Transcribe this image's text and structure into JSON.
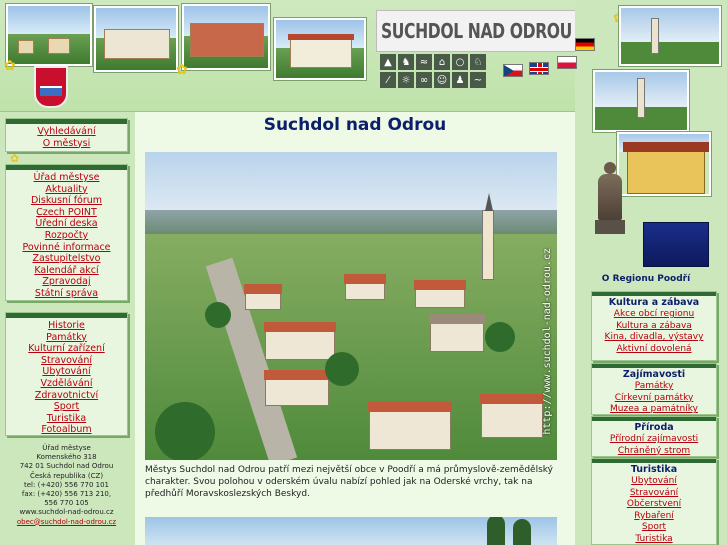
{
  "header": {
    "site_title": "SUCHDOL NAD ODROU",
    "category_icons": [
      "tent-icon",
      "hiker-icon",
      "fish-icon",
      "camp-icon",
      "cyclist-icon",
      "horse-icon",
      "ski-icon",
      "sun-icon",
      "bike-icon",
      "theater-icon",
      "running-icon",
      "waves-icon"
    ],
    "languages": [
      "de",
      "cz",
      "gb",
      "pl"
    ]
  },
  "left_nav": {
    "box1": [
      "Vyhledávání",
      "O městysi"
    ],
    "box2": [
      "Úřad městyse",
      "Aktuality",
      "Diskusní fórum",
      "Czech POINT",
      "Úřední deska",
      "Rozpočty",
      "Povinné informace",
      "Zastupitelstvo",
      "Kalendář akcí",
      "Zpravodaj",
      "Státní správa"
    ],
    "box3": [
      "Historie",
      "Památky",
      "Kulturní zařízení",
      "Stravování",
      "Ubytování",
      "Vzdělávání",
      "Zdravotnictví",
      "Sport",
      "Turistika",
      "Fotoalbum"
    ]
  },
  "address": {
    "line1": "Úřad městyse",
    "line2": "Komenského 318",
    "line3": "742 01 Suchdol nad Odrou",
    "line4": "Česká republika (CZ)",
    "line5": "tel: (+420) 556 770 101",
    "line6": "fax: (+420) 556 713 210,",
    "line7": "556 770 105",
    "line8": "www.suchdol-nad-odrou.cz",
    "email": "obec@suchdol-nad-odrou.cz"
  },
  "main": {
    "title": "Suchdol nad Odrou",
    "photo_watermark": "http://www.suchdol-nad-odrou.cz",
    "intro_text": "Městys Suchdol nad Odrou patří mezi největší obce v Poodří a má průmyslově-zemědělský charakter. Svou polohou v oderském úvalu nabízí pohled jak na Oderské vrchy, tak na předhůří Moravskoslezských Beskyd."
  },
  "right_nav": {
    "region_label": "O Regionu Poodří",
    "sections": [
      {
        "heading": "Kultura a zábava",
        "items": [
          "Akce obcí regionu",
          "Kultura a zábava",
          "Kina, divadla, výstavy",
          "Aktivní dovolená"
        ]
      },
      {
        "heading": "Zajímavosti",
        "items": [
          "Památky",
          "Církevní památky",
          "Muzea a památníky"
        ]
      },
      {
        "heading": "Příroda",
        "items": [
          "Přírodní zajímavosti",
          "Chráněný strom"
        ]
      },
      {
        "heading": "Turistika",
        "items": [
          "Ubytování",
          "Stravování",
          "Občerstvení",
          "Rybaření",
          "Sport",
          "Turistika"
        ]
      }
    ]
  },
  "colors": {
    "link_red": "#b8000e",
    "heading_navy": "#0b1f6a",
    "page_green": "#e6f7d9",
    "rail_green": "#2f6a35"
  }
}
